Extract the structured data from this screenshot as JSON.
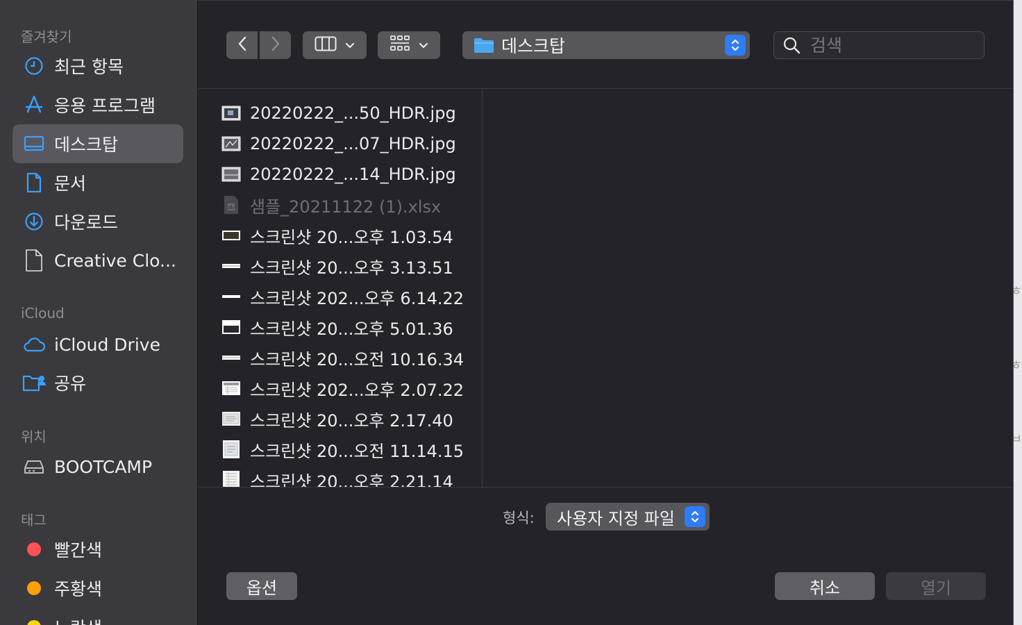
{
  "sidebar": {
    "favorites_title": "즐겨찾기",
    "favorites": [
      {
        "label": "최근 항목",
        "icon": "clock-icon"
      },
      {
        "label": "응용 프로그램",
        "icon": "apps-icon"
      },
      {
        "label": "데스크탑",
        "icon": "desktop-icon",
        "active": true
      },
      {
        "label": "문서",
        "icon": "document-icon"
      },
      {
        "label": "다운로드",
        "icon": "download-icon"
      },
      {
        "label": "Creative Clo...",
        "icon": "file-icon"
      }
    ],
    "icloud_title": "iCloud",
    "icloud": [
      {
        "label": "iCloud Drive",
        "icon": "cloud-icon"
      },
      {
        "label": "공유",
        "icon": "shared-folder-icon"
      }
    ],
    "locations_title": "위치",
    "locations": [
      {
        "label": "BOOTCAMP",
        "icon": "drive-icon"
      }
    ],
    "tags_title": "태그",
    "tags": [
      {
        "label": "빨간색",
        "color": "#ff5257"
      },
      {
        "label": "주황색",
        "color": "#ff9f0a"
      },
      {
        "label": "노란색",
        "color": "#ffd60a"
      }
    ]
  },
  "toolbar": {
    "location": "데스크탑",
    "search_placeholder": "검색"
  },
  "files": [
    {
      "name": "20220222_...50_HDR.jpg",
      "thumb": "photo"
    },
    {
      "name": "20220222_...07_HDR.jpg",
      "thumb": "photo"
    },
    {
      "name": "20220222_...14_HDR.jpg",
      "thumb": "photo"
    },
    {
      "name": "샘플_20211122 (1).xlsx",
      "thumb": "xlsx",
      "disabled": true
    },
    {
      "name": "스크린샷 20...오후 1.03.54",
      "thumb": "wide-dark"
    },
    {
      "name": "스크린샷 20...오후 3.13.51",
      "thumb": "strip"
    },
    {
      "name": "스크린샷 202...오후 6.14.22",
      "thumb": "line"
    },
    {
      "name": "스크린샷 20...오후 5.01.36",
      "thumb": "window"
    },
    {
      "name": "스크린샷 20...오전 10.16.34",
      "thumb": "strip"
    },
    {
      "name": "스크린샷 202...오후 2.07.22",
      "thumb": "doc"
    },
    {
      "name": "스크린샷 20...오후 2.17.40",
      "thumb": "doc"
    },
    {
      "name": "스크린샷 20...오전 11.14.15",
      "thumb": "doc"
    },
    {
      "name": "스크린샷 20...오후 2.21.14",
      "thumb": "doc"
    }
  ],
  "format": {
    "label": "형식:",
    "value": "사용자 지정 파일"
  },
  "buttons": {
    "options": "옵션",
    "cancel": "취소",
    "open": "열기"
  },
  "colors": {
    "accent": "#2e7cf6",
    "folder": "#4aa8ef"
  }
}
